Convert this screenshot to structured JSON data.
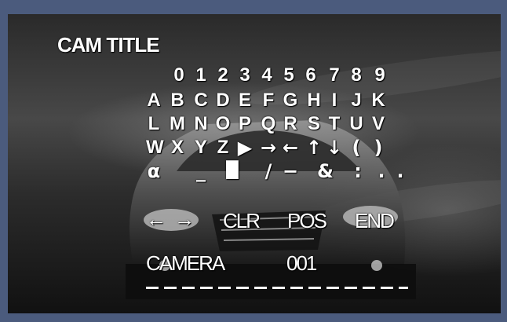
{
  "osd": {
    "title": "CAM TITLE",
    "digits": [
      "0",
      "1",
      "2",
      "3",
      "4",
      "5",
      "6",
      "7",
      "8",
      "9"
    ],
    "row1": [
      "A",
      "B",
      "C",
      "D",
      "E",
      "F",
      "G",
      "H",
      "I",
      "J",
      "K"
    ],
    "row2": [
      "L",
      "M",
      "N",
      "O",
      "P",
      "Q",
      "R",
      "S",
      "T",
      "U",
      "V"
    ],
    "row3": [
      "W",
      "X",
      "Y",
      "Z",
      "▶",
      "→",
      "←",
      "↑",
      "↓",
      "(",
      ")"
    ],
    "row4": [
      "α",
      "_",
      "█",
      "/",
      "−",
      "&",
      ":",
      ".",
      "."
    ],
    "commands": {
      "move_left": "←",
      "move_right": "→",
      "clear": "CLR",
      "position": "POS",
      "end": "END"
    },
    "current_title": "CAMERA",
    "camera_number": "001",
    "edit_line": "_ _ _ _ _ _ _ _ _ _ _ _ _ _ _"
  },
  "colors": {
    "border": "#4b5b7d",
    "text": "#ffffff"
  }
}
